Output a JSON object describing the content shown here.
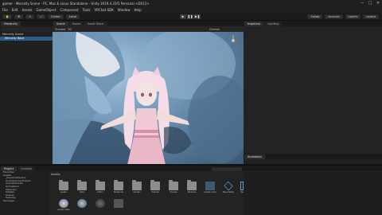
{
  "window": {
    "title": "gamer - Mercelly Scene - PC, Mac & Linux Standalone - Unity 2019.4.31f1 Personal <DX11>",
    "controls": [
      "—",
      "□",
      "✕"
    ]
  },
  "menu": [
    "File",
    "Edit",
    "Assets",
    "GameObject",
    "Component",
    "Tools",
    "VRChat SDK",
    "Window",
    "Help"
  ],
  "toolbar": {
    "left": [
      "Center",
      "Local"
    ],
    "right": [
      "Collab",
      "Account",
      "Layers",
      "Layout"
    ]
  },
  "hierarchy": {
    "tab": "Hierarchy",
    "items": [
      "Mercelly Scene",
      "Mercelly Base"
    ]
  },
  "scene_tabs": [
    "Scene",
    "Game",
    "Asset Store"
  ],
  "scene_toolbar": [
    "Shaded",
    "2D",
    "Gizmos"
  ],
  "inspector": {
    "tabs": [
      "Inspector",
      "Lighting"
    ]
  },
  "animation_panel": {
    "tab": "Animation"
  },
  "project": {
    "tabs": [
      "Project",
      "Console"
    ],
    "breadcrumb": "Assets",
    "tree": [
      "Favorites",
      "Assets",
      "_PoiyomiShaders",
      "AnimationControllers",
      "AnimationSets",
      "Animations",
      "Materials",
      "Prefabs",
      "Scenes",
      "Textures",
      "Packages"
    ],
    "assets": [
      "Avatar",
      "Data",
      "Editor",
      "Materials",
      "Models",
      "Prefabs",
      "Scenes",
      "Textures",
      "avatar.unity",
      "Base Mesh",
      "Avatar Blend",
      "Avatar Mats"
    ]
  }
}
